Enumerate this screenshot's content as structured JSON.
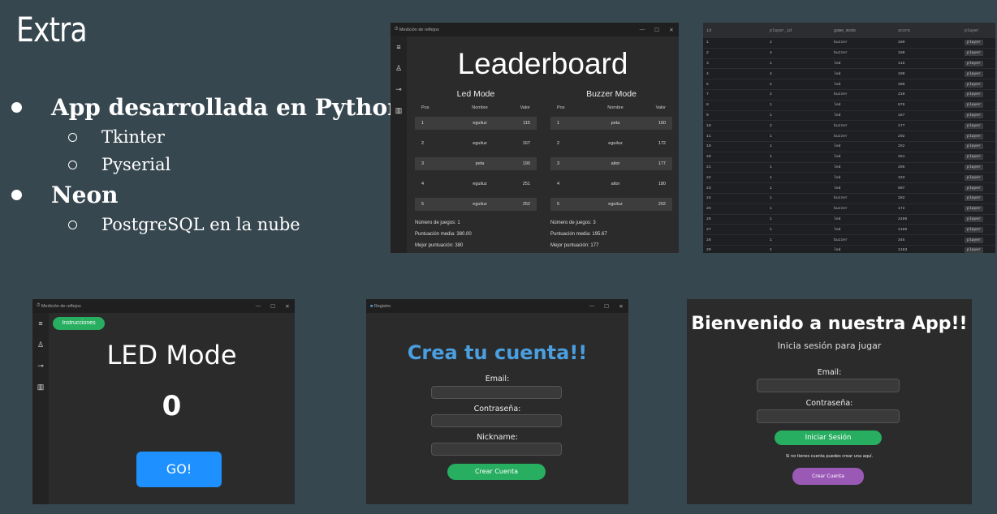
{
  "slide": {
    "title": "Extra",
    "bullets": [
      {
        "label": "App desarrollada en Python",
        "sub": [
          "Tkinter",
          "Pyserial"
        ]
      },
      {
        "label": "Neon",
        "sub": [
          "PostgreSQL en la nube"
        ]
      }
    ]
  },
  "leaderboard_window": {
    "window_title": "Medición de reflejos",
    "title": "Leaderboard",
    "led": {
      "heading": "Led Mode",
      "columns": [
        "Pos",
        "Nombre",
        "Valor"
      ],
      "rows": [
        [
          "1",
          "eguiluz",
          "115"
        ],
        [
          "2",
          "eguiluz",
          "167"
        ],
        [
          "3",
          "peta",
          "190"
        ],
        [
          "4",
          "eguiluz",
          "251"
        ],
        [
          "5",
          "eguiluz",
          "252"
        ]
      ],
      "stats": [
        "Número de juegos: 1",
        "Puntuación media: 380.00",
        "Mejor puntuación: 380"
      ]
    },
    "buzzer": {
      "heading": "Buzzer Mode",
      "columns": [
        "Pos",
        "Nombre",
        "Valor"
      ],
      "rows": [
        [
          "1",
          "peta",
          "160"
        ],
        [
          "2",
          "eguiluz",
          "172"
        ],
        [
          "3",
          "aitor",
          "177"
        ],
        [
          "4",
          "aitor",
          "180"
        ],
        [
          "5",
          "eguiluz",
          "202"
        ]
      ],
      "stats": [
        "Número de juegos: 3",
        "Puntuación media: 195.67",
        "Mejor puntuación: 177"
      ]
    }
  },
  "db_table": {
    "columns": [
      "id",
      "player_id",
      "game_mode",
      "score",
      "player"
    ],
    "rows": [
      [
        "1",
        "2",
        "buzzer",
        "180",
        "player"
      ],
      [
        "2",
        "4",
        "buzzer",
        "180",
        "player"
      ],
      [
        "3",
        "1",
        "led",
        "115",
        "player"
      ],
      [
        "4",
        "4",
        "led",
        "190",
        "player"
      ],
      [
        "5",
        "2",
        "led",
        "380",
        "player"
      ],
      [
        "7",
        "2",
        "buzzer",
        "210",
        "player"
      ],
      [
        "8",
        "1",
        "led",
        "876",
        "player"
      ],
      [
        "9",
        "1",
        "led",
        "167",
        "player"
      ],
      [
        "10",
        "2",
        "buzzer",
        "177",
        "player"
      ],
      [
        "11",
        "1",
        "buzzer",
        "202",
        "player"
      ],
      [
        "19",
        "1",
        "led",
        "252",
        "player"
      ],
      [
        "20",
        "1",
        "led",
        "251",
        "player"
      ],
      [
        "21",
        "1",
        "led",
        "295",
        "player"
      ],
      [
        "22",
        "1",
        "led",
        "333",
        "player"
      ],
      [
        "23",
        "1",
        "led",
        "807",
        "player"
      ],
      [
        "24",
        "1",
        "buzzer",
        "282",
        "player"
      ],
      [
        "25",
        "1",
        "buzzer",
        "172",
        "player"
      ],
      [
        "26",
        "1",
        "led",
        "2486",
        "player"
      ],
      [
        "27",
        "1",
        "led",
        "1186",
        "player"
      ],
      [
        "28",
        "1",
        "buzzer",
        "345",
        "player"
      ],
      [
        "29",
        "1",
        "led",
        "1183",
        "player"
      ]
    ]
  },
  "led_window": {
    "window_title": "Medición de reflejos",
    "instructions_label": "Instrucciones",
    "title": "LED Mode",
    "counter": "0",
    "go_label": "GO!"
  },
  "register_window": {
    "window_title": "Registro",
    "title": "Crea tu cuenta!!",
    "email_label": "Email:",
    "password_label": "Contraseña:",
    "nickname_label": "Nickname:",
    "create_label": "Crear Cuenta"
  },
  "login_window": {
    "title": "Bienvenido a nuestra App!!",
    "subtitle": "Inicia sesión para jugar",
    "email_label": "Email:",
    "password_label": "Contraseña:",
    "login_label": "Iniciar Sesión",
    "hint": "Si no tienes cuenta puedes crear una aquí.",
    "create_label": "Crear Cuenta"
  },
  "colors": {
    "background": "#37474f",
    "green": "#27ae60",
    "blue": "#1e90ff",
    "purple": "#9b59b6",
    "title_blue": "#4a9fe0"
  }
}
